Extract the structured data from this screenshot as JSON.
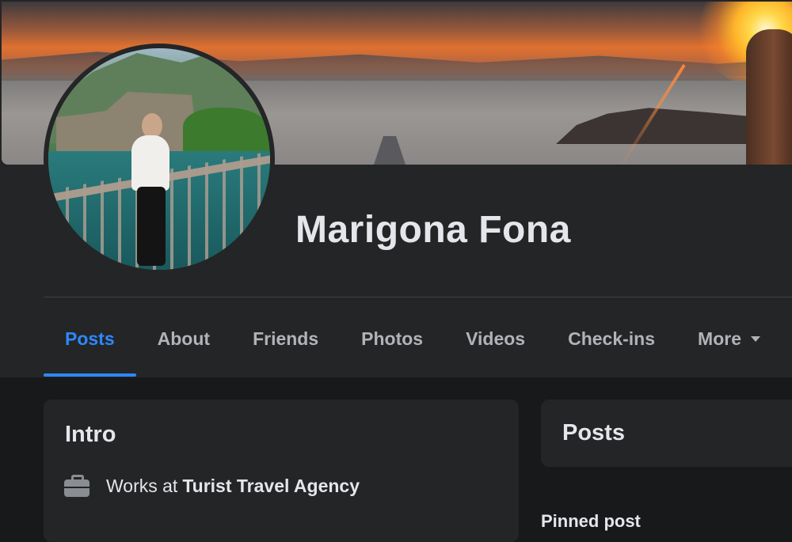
{
  "profile": {
    "name": "Marigona Fona"
  },
  "tabs": [
    {
      "label": "Posts",
      "active": true
    },
    {
      "label": "About"
    },
    {
      "label": "Friends"
    },
    {
      "label": "Photos"
    },
    {
      "label": "Videos"
    },
    {
      "label": "Check-ins"
    },
    {
      "label": "More",
      "icon": "caret-down-icon"
    }
  ],
  "intro": {
    "title": "Intro",
    "work": {
      "icon": "briefcase-icon",
      "prefix": "Works at",
      "employer": "Turist Travel Agency"
    }
  },
  "posts": {
    "title": "Posts",
    "pinned_label": "Pinned post"
  },
  "colors": {
    "background": "#18191a",
    "panel": "#242526",
    "accent": "#2d88ff",
    "text_primary": "#e4e6eb",
    "text_secondary": "#b0b3b8"
  }
}
